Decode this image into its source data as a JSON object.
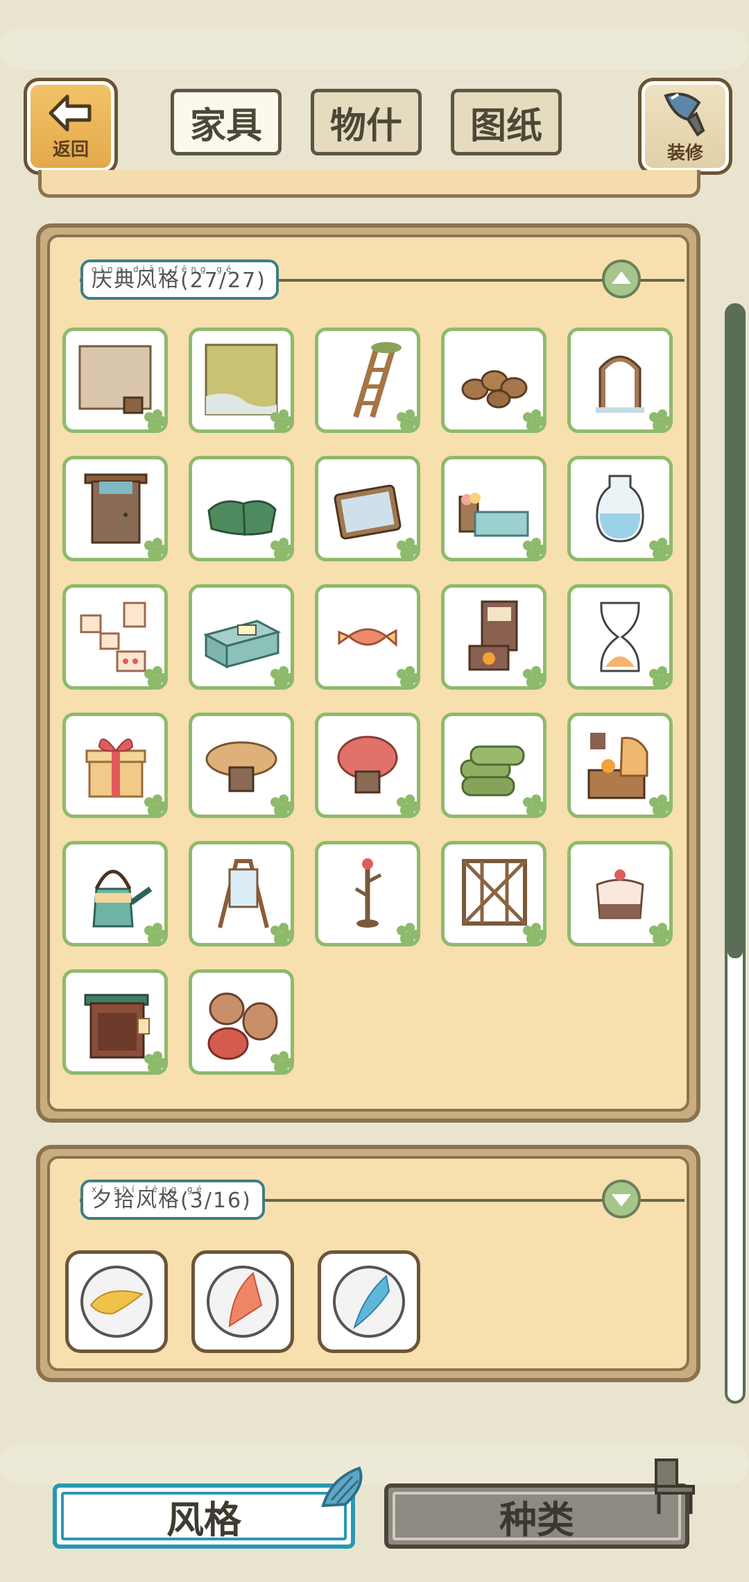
{
  "topbar": {
    "back_label": "返回",
    "decor_label": "装修",
    "tabs": [
      {
        "label": "家具",
        "active": true
      },
      {
        "label": "物什",
        "active": false
      },
      {
        "label": "图纸",
        "active": false
      }
    ]
  },
  "sections": [
    {
      "pinyin": "qìng diǎn fēng gé",
      "title": "庆典风格",
      "count": "(27/27)",
      "expanded": true,
      "items": [
        "wall-tub",
        "grass-floor",
        "ladder",
        "clay-pots",
        "arched-window",
        "wooden-door",
        "green-sleeping-bag",
        "tablet",
        "bed",
        "water-vase",
        "memo-board",
        "green-chest",
        "candy",
        "fireplace-shelf",
        "hourglass",
        "gift-box",
        "tan-mushroom-stool",
        "red-mushroom-stool",
        "hay-rolls",
        "kitchen-stove",
        "watering-can",
        "easel-mirror",
        "coat-rack",
        "wooden-fence",
        "cake",
        "wooden-cabinet",
        "sacks"
      ]
    },
    {
      "pinyin": "xī shí fēng gé",
      "title": "夕拾风格",
      "count": "(3/16)",
      "expanded": false,
      "items": [
        "yellow-marble",
        "red-marble",
        "blue-marble"
      ]
    }
  ],
  "bottom": {
    "style_label": "风格",
    "kind_label": "种类"
  },
  "colors": {
    "card_border": "#8eba6c",
    "panel": "#f7dfae",
    "accent_blue": "#2a98b3"
  }
}
